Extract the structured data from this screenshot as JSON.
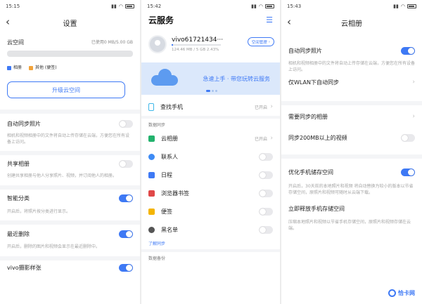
{
  "screen1": {
    "status": {
      "time": "15:15"
    },
    "header": {
      "title": "设置"
    },
    "cloud": {
      "label": "云空间",
      "usage": "已使用0 MB/5.00 GB"
    },
    "legend": [
      {
        "label": "相册",
        "color": "#3e79f5"
      },
      {
        "label": "其他 (便签)",
        "color": "#f2a33a"
      }
    ],
    "upgrade_button": "升级云空间",
    "items": [
      {
        "title": "自动同步照片",
        "desc": "相机和视频相册中的文件将自动上传存储在云端，方便您在所有设备上访问。",
        "toggle": false
      },
      {
        "title": "共享相册",
        "desc": "创建共享相册与他人分享照片、视频，并订阅他人的相册。",
        "toggle": false
      },
      {
        "title": "智能分类",
        "desc": "开启后，将照片按分类进行显示。",
        "toggle": true
      },
      {
        "title": "最近删除",
        "desc": "开启后，删除的图片和视频会显示在最近删除中。",
        "toggle": true
      },
      {
        "title": "vivo摄影样张",
        "desc": "",
        "toggle": true
      }
    ]
  },
  "screen2": {
    "status": {
      "time": "15:42"
    },
    "title": "云服务",
    "account": {
      "name": "vivo61721434···",
      "quota": "124.46 MB / 5 GB 2.43%",
      "quota_fraction": 0.0243,
      "space_button": "空间管理"
    },
    "banner": "急速上手 · 带您玩转云服务",
    "find_phone": {
      "label": "查找手机",
      "state": "已开启"
    },
    "sync_section": "数据同步",
    "sync_items": [
      {
        "label": "云相册",
        "state": "已开启",
        "icon": "photo-icon",
        "color": "#23b26d",
        "kind": "chevron"
      },
      {
        "label": "联系人",
        "icon": "person-icon",
        "color": "#3e8bf5",
        "kind": "toggle"
      },
      {
        "label": "日程",
        "icon": "calendar-check-icon",
        "color": "#3e79f5",
        "kind": "toggle"
      },
      {
        "label": "浏览器书签",
        "icon": "bookmark-icon",
        "color": "#e04848",
        "kind": "toggle"
      },
      {
        "label": "便签",
        "icon": "note-icon",
        "color": "#f4b400",
        "kind": "toggle"
      },
      {
        "label": "黑名单",
        "icon": "person-block-icon",
        "color": "#555555",
        "kind": "toggle"
      }
    ],
    "learn_link": "了解同步",
    "backup_section": "数据备份"
  },
  "screen3": {
    "status": {
      "time": "15:43"
    },
    "header": {
      "title": "云相册"
    },
    "auto_sync": {
      "title": "自动同步照片",
      "desc": "相机和视频相册中的文件将自动上传存储在云端，方便您在所有设备上访问。",
      "toggle": true
    },
    "wlan_only": "仅WLAN下自动同步",
    "albums_to_sync": "需要同步的相册",
    "sync_large_video": "同步200MB以上的视频",
    "optimize_storage": {
      "title": "优化手机储存空间",
      "desc": "开启后，30天前的本地照片和视频 将自动替换为较小的版本以节省存储空间，原照片和视频可随时从云端下载。",
      "toggle": true
    },
    "free_space": {
      "title": "立即释放手机存储空间",
      "desc": "压缩本地照片和视频以节省手机存储空间，原照片和视频存储在云端。"
    }
  },
  "watermark": "恰卡网"
}
